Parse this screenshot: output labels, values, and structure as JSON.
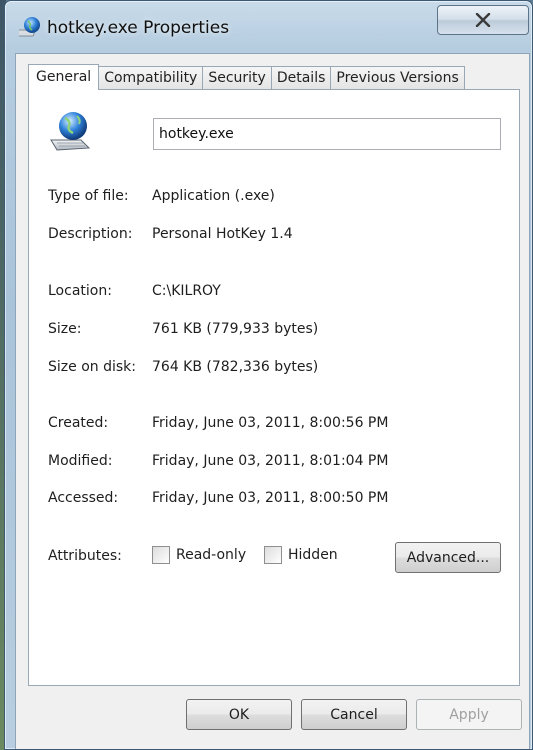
{
  "window": {
    "title": "hotkey.exe Properties"
  },
  "tabs": [
    {
      "label": "General",
      "active": true
    },
    {
      "label": "Compatibility",
      "active": false
    },
    {
      "label": "Security",
      "active": false
    },
    {
      "label": "Details",
      "active": false
    },
    {
      "label": "Previous Versions",
      "active": false
    }
  ],
  "general": {
    "file_name": "hotkey.exe",
    "type_label": "Type of file:",
    "type_value": "Application (.exe)",
    "description_label": "Description:",
    "description_value": "Personal HotKey 1.4",
    "location_label": "Location:",
    "location_value": "C:\\KILROY",
    "size_label": "Size:",
    "size_value": "761 KB (779,933 bytes)",
    "size_on_disk_label": "Size on disk:",
    "size_on_disk_value": "764 KB (782,336 bytes)",
    "created_label": "Created:",
    "created_value": "Friday, June 03, 2011, 8:00:56 PM",
    "modified_label": "Modified:",
    "modified_value": "Friday, June 03, 2011, 8:01:04 PM",
    "accessed_label": "Accessed:",
    "accessed_value": "Friday, June 03, 2011, 8:00:50 PM",
    "attributes_label": "Attributes:",
    "read_only_label": "Read-only",
    "read_only_checked": false,
    "hidden_label": "Hidden",
    "hidden_checked": false,
    "advanced_label": "Advanced..."
  },
  "footer": {
    "ok_label": "OK",
    "cancel_label": "Cancel",
    "apply_label": "Apply"
  },
  "icons": {
    "title": "globe-computer-icon",
    "file": "globe-computer-icon",
    "close": "close-icon"
  }
}
